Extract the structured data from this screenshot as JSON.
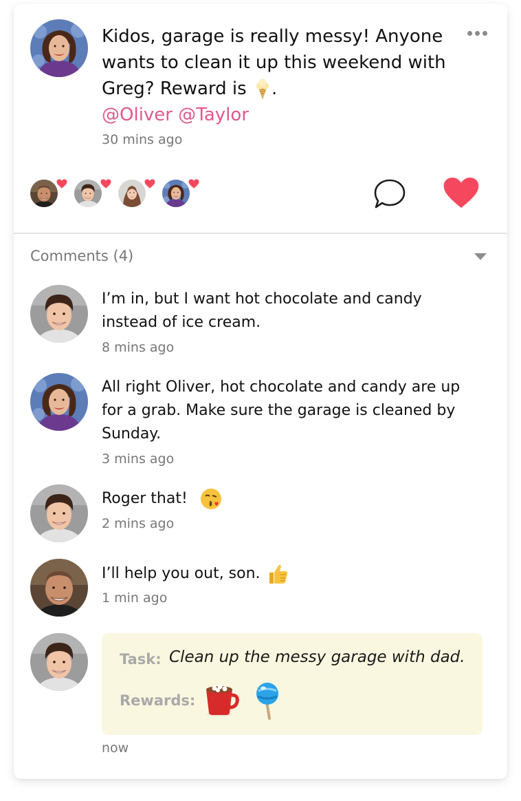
{
  "post": {
    "author": "Mom",
    "text": "Kidos, garage is really messy! Anyone wants to clean it up this weekend with Greg? Reward is",
    "text_suffix": ".",
    "mentions": "@Oliver @Taylor",
    "time": "30 mins ago",
    "emoji": "ice-cream-icon"
  },
  "likers": [
    "Greg",
    "Oliver",
    "Taylor",
    "Mom"
  ],
  "colors": {
    "accent": "#e0588d",
    "heart": "#f5485f",
    "task_bg": "#faf7e0"
  },
  "comments_header": "Comments (4)",
  "comments": [
    {
      "author": "Oliver",
      "text_lines": [
        "I’m in, but I want hot chocolate and candy",
        "instead of ice cream."
      ],
      "time": "8 mins ago"
    },
    {
      "author": "Mom",
      "text_lines": [
        "All right Oliver, hot chocolate and candy are up",
        "for a grab. Make sure the garage is cleaned by",
        "Sunday."
      ],
      "time": "3 mins ago"
    },
    {
      "author": "Oliver",
      "text_lines": [
        "Roger that!"
      ],
      "emoji": "kissing-face-icon",
      "time": "2 mins ago"
    },
    {
      "author": "Greg",
      "text_lines": [
        "I’ll help you out, son."
      ],
      "emoji": "thumbs-up-icon",
      "time": "1 min ago"
    }
  ],
  "task": {
    "author": "Oliver",
    "task_label": "Task:",
    "task_value": "Clean up the messy garage with dad.",
    "rewards_label": "Rewards:",
    "rewards": [
      "hot-chocolate-icon",
      "lollipop-icon"
    ],
    "time": "now"
  }
}
